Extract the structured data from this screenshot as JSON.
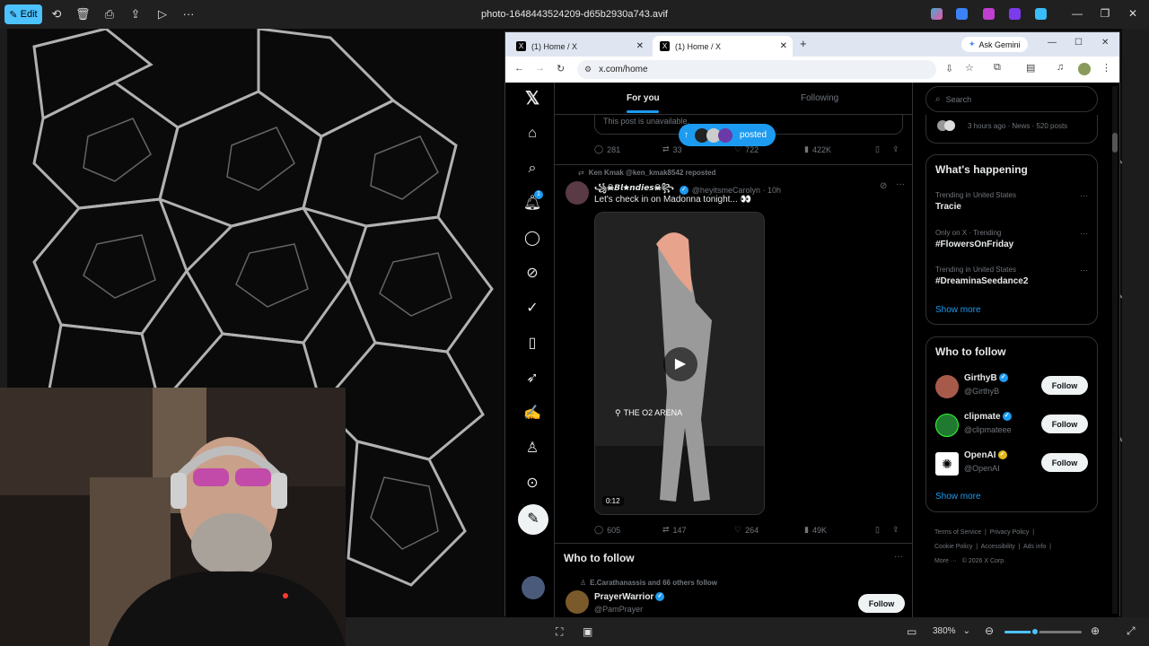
{
  "photos_app": {
    "edit_label": "Edit",
    "file_title": "photo-1648443524209-d65b2930a743.avif",
    "zoom": "380%",
    "zoom_fraction": 0.4
  },
  "browser": {
    "tabs": [
      {
        "label": "(1) Home / X",
        "active": false
      },
      {
        "label": "(1) Home / X",
        "active": true
      }
    ],
    "new_tab": "+",
    "ask_gemini": "Ask Gemini",
    "url": "x.com/home"
  },
  "x": {
    "nav_badge": "1",
    "tabs": {
      "for_you": "For you",
      "following": "Following"
    },
    "new_posts_pill": "posted",
    "prev_post": {
      "unavailable_text": "This post is unavailable.",
      "replies": "281",
      "reposts": "33",
      "likes": "722",
      "views": "422K"
    },
    "post": {
      "repost_context": "Ken Kmak @ken_kmak8542 reposted",
      "display_name": "꧁☠︎𝘽𝙡🟊𝙣𝙙𝙞𝙚𝙨☠︎꧂",
      "handle": "@heyitsmeCarolyn · 10h",
      "text": "Let's check in on Madonna tonight... 👀",
      "video_location": "THE O2 ARENA",
      "video_time": "0:12",
      "replies": "605",
      "reposts": "147",
      "likes": "264",
      "views": "49K"
    },
    "who_to_follow_feed": {
      "title": "Who to follow",
      "context": "E.Carathanassis and 66 others follow",
      "name": "PrayerWarrior",
      "handle": "@PamPrayer",
      "follow": "Follow"
    },
    "search_placeholder": "Search",
    "top_snippet": "3 hours ago · News · 520 posts",
    "whats_happening": {
      "title": "What's happening",
      "trends": [
        {
          "context": "Trending in United States",
          "name": "Tracie"
        },
        {
          "context": "Only on X · Trending",
          "name": "#FlowersOnFriday"
        },
        {
          "context": "Trending in United States",
          "name": "#DreaminaSeedance2"
        }
      ],
      "show_more": "Show more"
    },
    "who_to_follow": {
      "title": "Who to follow",
      "accounts": [
        {
          "name": "GirthyB",
          "handle": "@GirthyB",
          "follow": "Follow"
        },
        {
          "name": "clipmate",
          "handle": "@clipmateee",
          "follow": "Follow"
        },
        {
          "name": "OpenAI",
          "handle": "@OpenAI",
          "follow": "Follow"
        }
      ],
      "show_more": "Show more"
    },
    "footer": {
      "terms": "Terms of Service",
      "privacy": "Privacy Policy",
      "cookie": "Cookie Policy",
      "accessibility": "Accessibility",
      "ads": "Ads info",
      "more": "More ···",
      "copyright": "© 2026 X Corp."
    }
  }
}
